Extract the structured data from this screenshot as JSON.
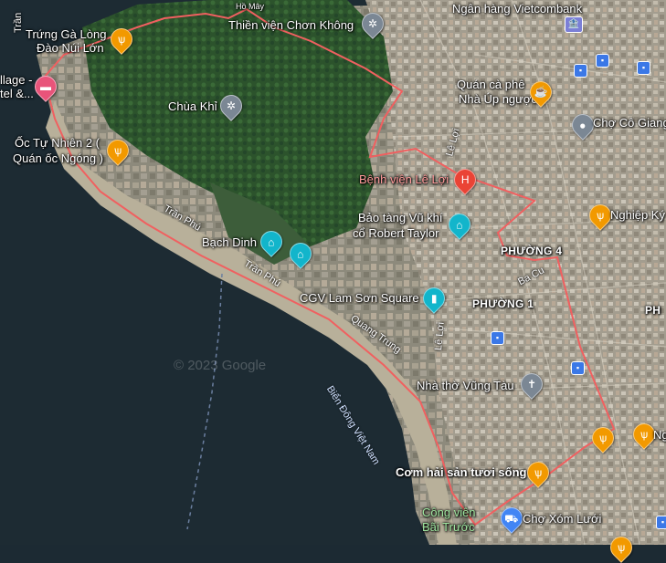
{
  "map": {
    "watermark": "© 2023 Google",
    "colors": {
      "route": "#f25c5c",
      "sea": "#1c2a33",
      "forest": "#2f5a2f",
      "urban": "#9c9686"
    }
  },
  "places": {
    "ngan_hang": "Ngân hàng Vietcombank",
    "hon_may": "Hồ Mây",
    "thien_vien": "Thiền viện Chơn Không",
    "trung_ga_1": "Trứng Gà Lòng",
    "trung_ga_2": "Đào Núi Lớn",
    "hotel_1": "llage -",
    "hotel_2": "tel &...",
    "quan_cafe_1": "Quán cà phê",
    "quan_cafe_2": "Nhà Úp ngược",
    "cho_co_giang": "Chợ Cô Giang",
    "chua_khi": "Chùa Khỉ",
    "oc_tu_nhien_1": "Ốc Tự Nhiên 2 (",
    "oc_tu_nhien_2": "Quán ốc Ngóng )",
    "benh_vien": "Bệnh viện Lê Lợi",
    "nghiep_ky": "Nghiệp Ký",
    "bao_tang_1": "Bảo tàng Vũ khí",
    "bao_tang_2": "cổ Robert Taylor",
    "bach_dinh": "Bạch Dinh",
    "phuong_4": "PHƯỜNG 4",
    "phuong_1": "PHƯỜNG 1",
    "cgv": "CGV Lam Sơn Square",
    "nha_tho": "Nhà thờ Vũng Tàu",
    "com_hai_san": "Cơm hải sản tươi sống",
    "cong_vien_1": "Công viên",
    "cong_vien_2": "Bãi Trước",
    "cho_xom_luoi": "Chợ Xóm Lưới",
    "edge_ph": "PH",
    "edge_ng": "Ng",
    "tran_label": "Trần"
  },
  "roads": {
    "tran_phu_1": "Trần Phú",
    "tran_phu_2": "Trần Phú",
    "quang_trung": "Quang Trung",
    "le_loi_1": "Lê Lợi",
    "le_loi_2": "Lê Lợi",
    "ba_cu": "Ba Cu"
  },
  "sea": {
    "bien_dong": "Biển Đông Việt Nam"
  },
  "icons": {
    "restaurant": "fork-knife-icon",
    "cafe": "coffee-cup-icon",
    "hospital": "hospital-icon",
    "museum": "museum-icon",
    "temple": "temple-wheel-icon",
    "church": "church-icon",
    "market": "shopping-cart-icon",
    "hotel": "bed-icon",
    "bank": "bank-icon",
    "bus": "bus-stop-icon"
  }
}
